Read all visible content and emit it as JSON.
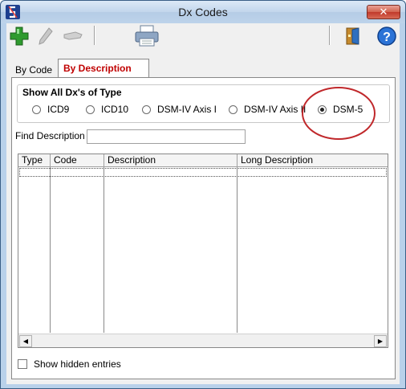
{
  "window": {
    "title": "Dx Codes",
    "close_label": "✕"
  },
  "toolbar": {
    "icons": [
      "add-icon",
      "edit-icon",
      "delete-icon",
      "print-icon",
      "exit-icon",
      "help-icon"
    ]
  },
  "tabs": [
    {
      "label": "By Code",
      "active": false
    },
    {
      "label": "By Description",
      "active": true
    }
  ],
  "type_group": {
    "title": "Show All Dx's of Type",
    "options": [
      {
        "label": "ICD9",
        "selected": false
      },
      {
        "label": "ICD10",
        "selected": false
      },
      {
        "label": "DSM-IV Axis I",
        "selected": false
      },
      {
        "label": "DSM-IV Axis II",
        "selected": false
      },
      {
        "label": "DSM-5",
        "selected": true
      }
    ]
  },
  "find": {
    "label": "Find Description",
    "value": ""
  },
  "grid": {
    "columns": [
      "Type",
      "Code",
      "Description",
      "Long Description"
    ],
    "rows": []
  },
  "show_hidden": {
    "label": "Show hidden entries",
    "checked": false
  },
  "colors": {
    "active_tab_text": "#c00000",
    "highlight_ring": "#c0282b"
  }
}
